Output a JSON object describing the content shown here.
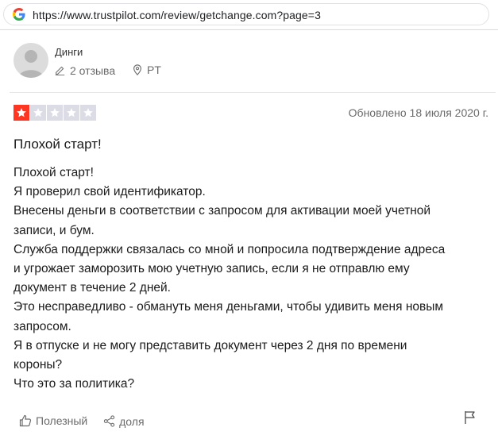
{
  "browser": {
    "url": "https://www.trustpilot.com/review/getchange.com?page=3"
  },
  "reviewer": {
    "name": "Динги",
    "reviews_count": "2 отзыва",
    "country": "PT"
  },
  "review": {
    "rating": 1,
    "max_rating": 5,
    "updated": "Обновлено 18 июля 2020 г.",
    "title": "Плохой старт!",
    "body_lines": [
      "Плохой старт!",
      "Я проверил свой идентификатор.",
      "Внесены деньги в соответствии с запросом для активации моей учетной",
      "записи, и бум.",
      "Служба поддержки связалась со мной и попросила подтверждение адреса",
      "и угрожает заморозить мою учетную запись, если я не отправлю ему",
      "документ в течение 2 дней.",
      "Это несправедливо - обмануть меня деньгами, чтобы удивить меня новым",
      "запросом.",
      "Я в отпуске и не могу представить документ через 2 дня по времени",
      "короны?",
      "Что это за политика?"
    ]
  },
  "actions": {
    "useful_label": "Полезный",
    "share_label": "доля"
  },
  "colors": {
    "star_filled": "#ff3722",
    "star_empty": "#dcdce6"
  }
}
